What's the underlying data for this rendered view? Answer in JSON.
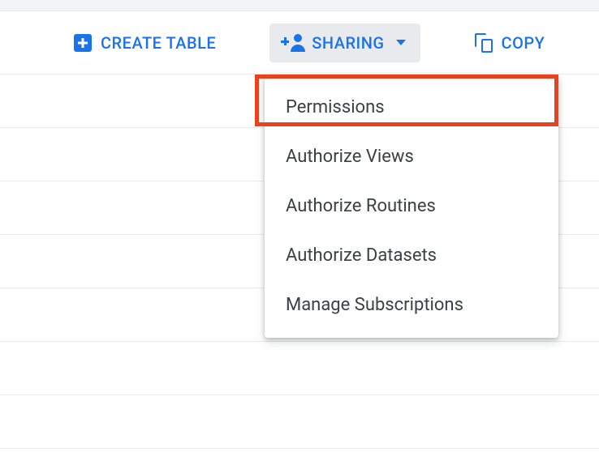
{
  "toolbar": {
    "create_table_label": "Create Table",
    "sharing_label": "Sharing",
    "copy_label": "Copy"
  },
  "sharing_menu": {
    "items": [
      {
        "label": "Permissions"
      },
      {
        "label": "Authorize Views"
      },
      {
        "label": "Authorize Routines"
      },
      {
        "label": "Authorize Datasets"
      },
      {
        "label": "Manage Subscriptions"
      }
    ]
  },
  "highlight": {
    "color": "#e8421e"
  }
}
